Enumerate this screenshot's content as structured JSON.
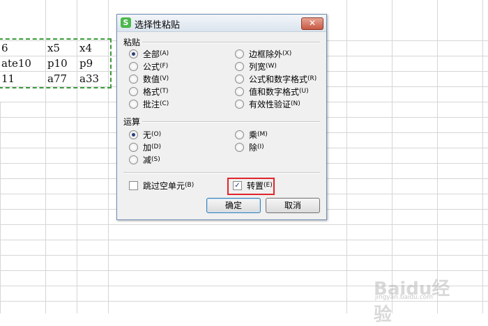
{
  "sheet": {
    "rows": [
      [
        "6",
        "x5",
        "x4"
      ],
      [
        "ate10",
        "p10",
        "p9"
      ],
      [
        "11",
        "a77",
        "a33"
      ]
    ]
  },
  "dialog": {
    "app_icon": "S",
    "title": "选择性粘贴",
    "close_symbol": "✕",
    "paste_section": "粘贴",
    "paste_options_left": [
      {
        "label": "全部",
        "key": "(A)",
        "selected": true
      },
      {
        "label": "公式",
        "key": "(F)",
        "selected": false
      },
      {
        "label": "数值",
        "key": "(V)",
        "selected": false
      },
      {
        "label": "格式",
        "key": "(T)",
        "selected": false
      },
      {
        "label": "批注",
        "key": "(C)",
        "selected": false
      }
    ],
    "paste_options_right": [
      {
        "label": "边框除外",
        "key": "(X)",
        "selected": false
      },
      {
        "label": "列宽",
        "key": "(W)",
        "selected": false
      },
      {
        "label": "公式和数字格式",
        "key": "(R)",
        "selected": false
      },
      {
        "label": "值和数字格式",
        "key": "(U)",
        "selected": false
      },
      {
        "label": "有效性验证",
        "key": "(N)",
        "selected": false
      }
    ],
    "operation_section": "运算",
    "operation_left": [
      {
        "label": "无",
        "key": "(O)",
        "selected": true
      },
      {
        "label": "加",
        "key": "(D)",
        "selected": false
      },
      {
        "label": "减",
        "key": "(S)",
        "selected": false
      }
    ],
    "operation_right": [
      {
        "label": "乘",
        "key": "(M)",
        "selected": false
      },
      {
        "label": "除",
        "key": "(I)",
        "selected": false
      }
    ],
    "skip_blanks": {
      "label": "跳过空单元",
      "key": "(B)",
      "checked": false
    },
    "transpose": {
      "label": "转置",
      "key": "(E)",
      "checked": true
    },
    "ok_label": "确定",
    "cancel_label": "取消"
  },
  "watermark": {
    "brand": "Baidu经验",
    "url": "jingyan.baidu.com"
  },
  "colors": {
    "copy_border": "#3a9a3a",
    "highlight": "#e0242a",
    "selected_radio": "#2a3f7a"
  }
}
